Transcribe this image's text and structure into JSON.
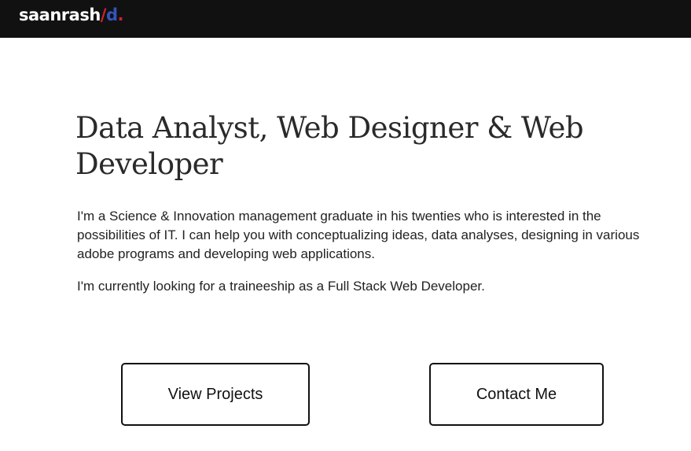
{
  "header": {
    "logo": {
      "main": "saanrash",
      "slash": "/",
      "tail": "d",
      "dot": "."
    }
  },
  "hero": {
    "headline": "Data Analyst, Web Designer & Web Developer",
    "paragraphs": [
      "I'm a Science & Innovation management graduate in his twenties who is interested in the possibilities of IT. I can help you with conceptualizing ideas, data analyses, designing in various adobe programs and developing web applications.",
      "I'm currently looking for a traineeship as a Full Stack Web Developer."
    ]
  },
  "actions": {
    "projects_label": "View Projects",
    "contact_label": "Contact Me"
  },
  "colors": {
    "topbar": "#111111",
    "logo_slash": "#cc2233",
    "logo_tail": "#3355bb"
  }
}
